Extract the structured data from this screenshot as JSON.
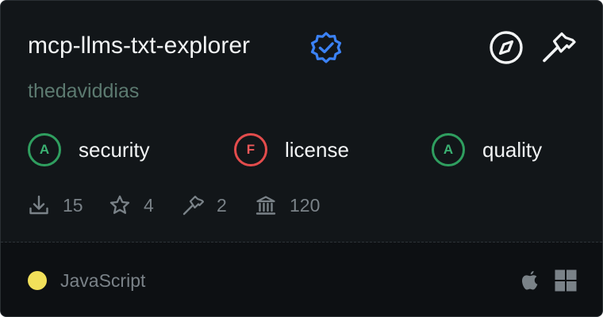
{
  "card": {
    "title": "mcp-llms-txt-explorer",
    "author": "thedaviddias",
    "icons": {
      "verified": "verified-badge-icon",
      "explore": "compass-icon",
      "tools": "hammer-icon"
    }
  },
  "scores": [
    {
      "grade": "A",
      "label": "security",
      "color": "#3bb273"
    },
    {
      "grade": "F",
      "label": "license",
      "color": "#f0595a"
    },
    {
      "grade": "A",
      "label": "quality",
      "color": "#3bb273"
    }
  ],
  "stats": [
    {
      "icon": "download-icon",
      "value": "15"
    },
    {
      "icon": "star-icon",
      "value": "4"
    },
    {
      "icon": "hammer-icon",
      "value": "2"
    },
    {
      "icon": "bank-icon",
      "value": "120"
    }
  ],
  "footer": {
    "language": "JavaScript",
    "language_color": "#f1e05a",
    "platforms": [
      "apple-icon",
      "windows-icon"
    ]
  },
  "colors": {
    "background": "#121619",
    "footer_background": "#0d1013",
    "accent_blue": "#3b82f6",
    "grade_a": "#3bb273",
    "grade_f": "#f0595a"
  }
}
